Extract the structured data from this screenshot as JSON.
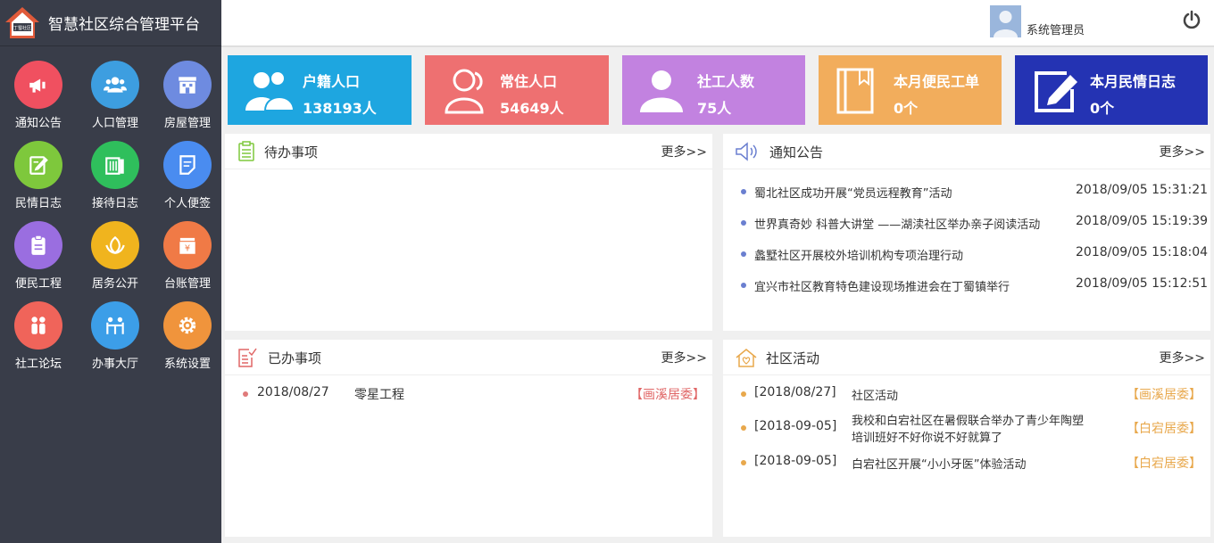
{
  "app": {
    "logo_text": "丁蜀社区",
    "title": "智慧社区综合管理平台"
  },
  "user": {
    "name": "系统管理员"
  },
  "colors": {
    "sidebar": "#393d49",
    "stat_population": "#1ea6e0",
    "stat_resident": "#ee7071",
    "stat_social": "#c282e0",
    "stat_service": "#f2ad5c",
    "stat_journal": "#2433b3"
  },
  "menu": [
    {
      "label": "通知公告",
      "icon": "megaphone-icon",
      "color": "#f05060"
    },
    {
      "label": "人口管理",
      "icon": "users-icon",
      "color": "#3d9ee0"
    },
    {
      "label": "房屋管理",
      "icon": "building-icon",
      "color": "#6e8be0"
    },
    {
      "label": "民情日志",
      "icon": "edit-icon",
      "color": "#7ec83c"
    },
    {
      "label": "接待日志",
      "icon": "books-icon",
      "color": "#2fbf5c"
    },
    {
      "label": "个人便签",
      "icon": "note-icon",
      "color": "#4a8cf0"
    },
    {
      "label": "便民工程",
      "icon": "clipboard-icon",
      "color": "#9a6ee0"
    },
    {
      "label": "居务公开",
      "icon": "leaf-icon",
      "color": "#f0b41e"
    },
    {
      "label": "台账管理",
      "icon": "ledger-icon",
      "color": "#f07a46"
    },
    {
      "label": "社工论坛",
      "icon": "people-icon",
      "color": "#f0645a"
    },
    {
      "label": "办事大厅",
      "icon": "meeting-icon",
      "color": "#3c9ee8"
    },
    {
      "label": "系统设置",
      "icon": "gear-icon",
      "color": "#f0943c"
    }
  ],
  "stats": [
    {
      "label": "户籍人口",
      "value": "138193人",
      "icon": "two-people-icon"
    },
    {
      "label": "常住人口",
      "value": "54649人",
      "icon": "resident-icon"
    },
    {
      "label": "社工人数",
      "value": "75人",
      "icon": "person-icon"
    },
    {
      "label": "本月便民工单",
      "value": "0个",
      "icon": "book-icon"
    },
    {
      "label": "本月民情日志",
      "value": "0个",
      "icon": "pen-square-icon"
    }
  ],
  "todo": {
    "title": "待办事项",
    "more": "更多>>"
  },
  "notices": {
    "title": "通知公告",
    "more": "更多>>",
    "items": [
      {
        "title": "蜀北社区成功开展“党员远程教育”活动",
        "time": "2018/09/05 15:31:21"
      },
      {
        "title": "世界真奇妙 科普大讲堂 ——湖渎社区举办亲子阅读活动",
        "time": "2018/09/05 15:19:39"
      },
      {
        "title": "蠡墅社区开展校外培训机构专项治理行动",
        "time": "2018/09/05 15:18:04"
      },
      {
        "title": "宜兴市社区教育特色建设现场推进会在丁蜀镇举行",
        "time": "2018/09/05 15:12:51"
      }
    ]
  },
  "done": {
    "title": "已办事项",
    "more": "更多>>",
    "items": [
      {
        "date": "2018/08/27",
        "name": "零星工程",
        "org": "【画溪居委】"
      }
    ]
  },
  "activities": {
    "title": "社区活动",
    "more": "更多>>",
    "items": [
      {
        "date": "[2018/08/27]",
        "name_line1": "社区活动",
        "name_line2": "",
        "org": "【画溪居委】"
      },
      {
        "date": "[2018-09-05]",
        "name_line1": "我校和白宕社区在暑假联合举办了青少年陶塑",
        "name_line2": "培训班好不好你说不好就算了",
        "org": "【白宕居委】"
      },
      {
        "date": "[2018-09-05]",
        "name_line1": "白宕社区开展“小小牙医”体验活动",
        "name_line2": "",
        "org": "【白宕居委】"
      }
    ]
  }
}
